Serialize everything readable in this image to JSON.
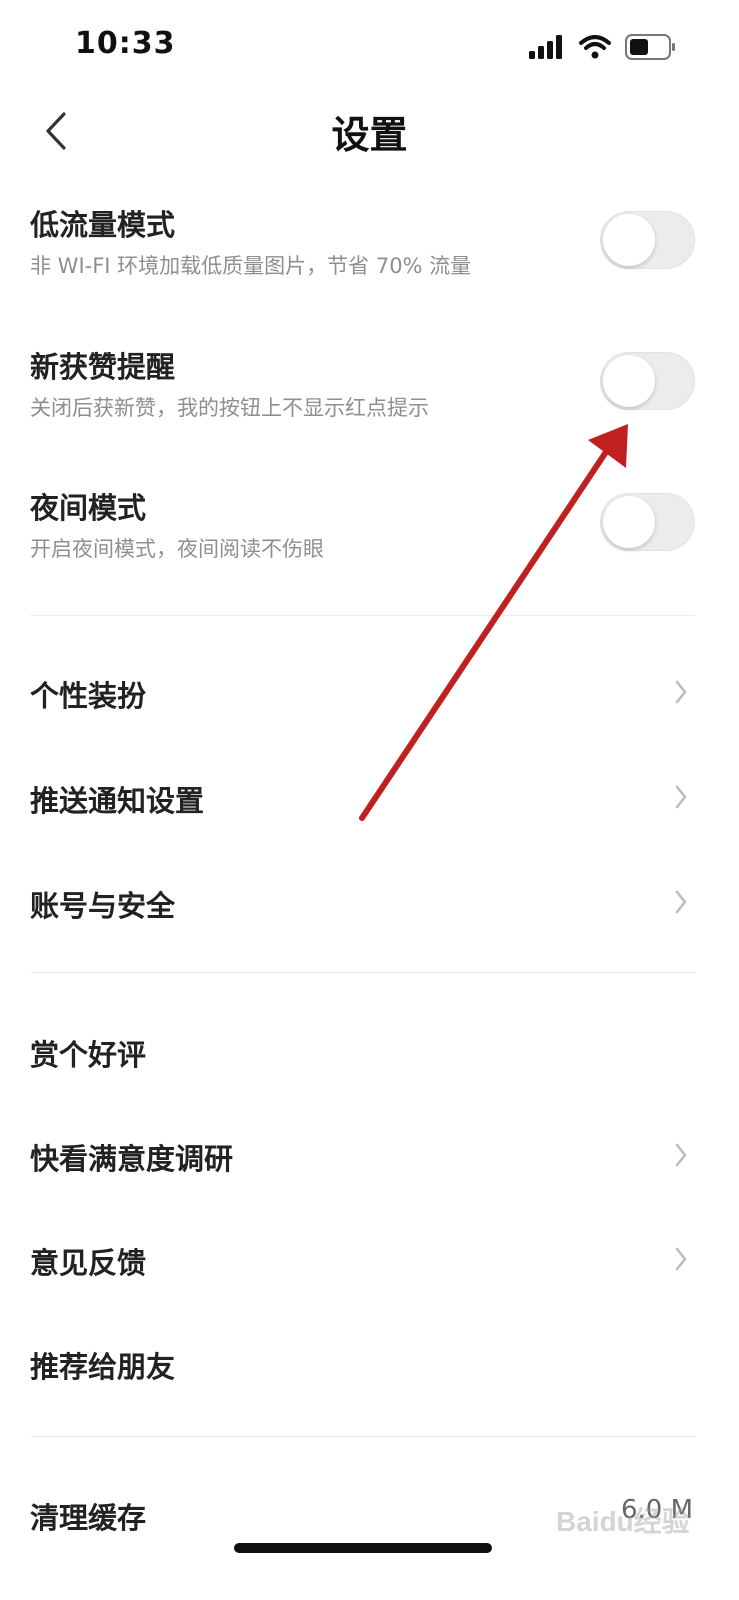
{
  "status_bar": {
    "time": "10:33",
    "icons": [
      "signal-icon",
      "wifi-icon",
      "battery-icon"
    ]
  },
  "nav": {
    "title": "设置",
    "back_icon": "chevron-left-icon"
  },
  "toggles": [
    {
      "title": "低流量模式",
      "subtitle": "非 WI-FI 环境加载低质量图片，节省 70% 流量",
      "on": false
    },
    {
      "title": "新获赞提醒",
      "subtitle": "关闭后获新赞，我的按钮上不显示红点提示",
      "on": false
    },
    {
      "title": "夜间模式",
      "subtitle": "开启夜间模式，夜间阅读不伤眼",
      "on": false
    }
  ],
  "section2": [
    {
      "label": "个性装扮",
      "chevron": true
    },
    {
      "label": "推送通知设置",
      "chevron": true
    },
    {
      "label": "账号与安全",
      "chevron": true
    }
  ],
  "section3": [
    {
      "label": "赏个好评",
      "chevron": false
    },
    {
      "label": "快看满意度调研",
      "chevron": true
    },
    {
      "label": "意见反馈",
      "chevron": true
    },
    {
      "label": "推荐给朋友",
      "chevron": false
    }
  ],
  "cache": {
    "label": "清理缓存",
    "value": "6.0 M"
  },
  "annotation": {
    "color": "#c0201f"
  },
  "watermark": "Baidu经验",
  "colors": {
    "toggle_off": "#ececec",
    "subtitle": "#8f8f8f",
    "divider": "#ececec"
  }
}
